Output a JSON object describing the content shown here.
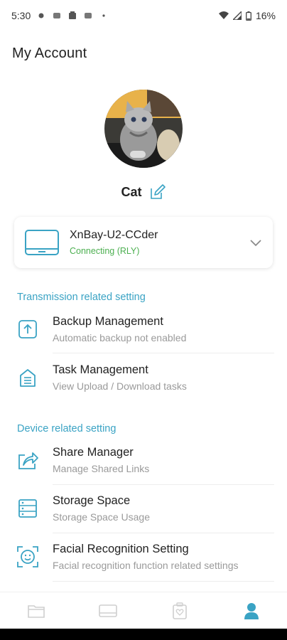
{
  "status_bar": {
    "time": "5:30",
    "battery": "16%"
  },
  "page_title": "My Account",
  "profile": {
    "username": "Cat"
  },
  "device": {
    "name": "XnBay-U2-CCder",
    "status": "Connecting (RLY)"
  },
  "sections": [
    {
      "header": "Transmission related setting",
      "items": [
        {
          "title": "Backup Management",
          "subtitle": "Automatic backup not enabled",
          "icon": "backup-upload-icon"
        },
        {
          "title": "Task Management",
          "subtitle": "View Upload / Download tasks",
          "icon": "task-list-icon"
        }
      ]
    },
    {
      "header": "Device related setting",
      "items": [
        {
          "title": "Share Manager",
          "subtitle": "Manage Shared Links",
          "icon": "share-icon"
        },
        {
          "title": "Storage Space",
          "subtitle": "Storage Space Usage",
          "icon": "storage-icon"
        },
        {
          "title": "Facial Recognition Setting",
          "subtitle": "Facial recognition function related settings",
          "icon": "face-scan-icon"
        }
      ]
    }
  ],
  "bottom_nav": [
    "folder-icon",
    "device-icon",
    "album-icon",
    "account-icon"
  ],
  "colors": {
    "accent": "#3aa3c4",
    "status_green": "#4caf50",
    "icon_teal": "#3aa3c4"
  }
}
